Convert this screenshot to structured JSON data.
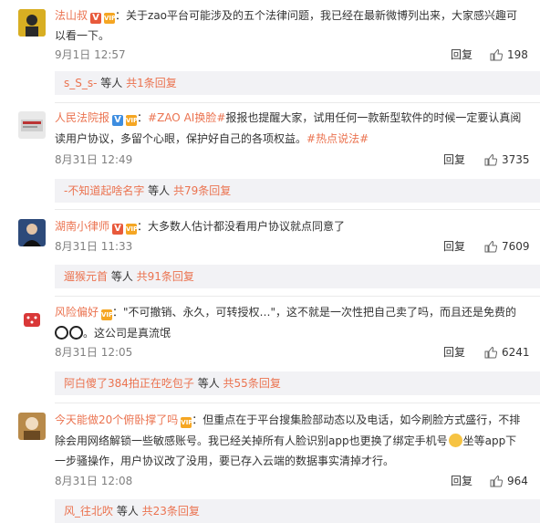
{
  "comments": [
    {
      "user": "法山叔",
      "text": "：关于zao平台可能涉及的五个法律问题，我已经在最新微博列出来，大家感兴趣可",
      "text2": "以看一下。",
      "time": "9月1日 12:57",
      "reply": "回复",
      "likes": "198",
      "sub_user": "s_S_s-",
      "sub_mid": " 等人 ",
      "sub_count": "共1条回复"
    },
    {
      "user": "人民法院报",
      "topic1": "#ZAO AI换脸#",
      "text": "报报也提醒大家，试用任何一款新型软件的时候一定要认真阅",
      "text2": "读用户协议，多留个心眼，保护好自己的各项权益。",
      "topic2": "#热点说法#",
      "time": "8月31日 12:49",
      "reply": "回复",
      "likes": "3735",
      "sub_user": "-不知道起啥名字",
      "sub_mid": " 等人 ",
      "sub_count": "共79条回复"
    },
    {
      "user": "湖南小律师",
      "text": "：大多数人估计都没看用户协议就点同意了",
      "time": "8月31日 11:33",
      "reply": "回复",
      "likes": "7609",
      "sub_user": "遛猴元首",
      "sub_mid": " 等人 ",
      "sub_count": "共91条回复"
    },
    {
      "user": "风险偏好",
      "text": "：\"不可撤销、永久，可转授权…\"，这不就是一次性把自己卖了吗，而且还是免费的",
      "text2": "。这公司是真流氓",
      "time": "8月31日 12:05",
      "reply": "回复",
      "likes": "6241",
      "sub_user": "阿白傻了384拍正在吃包子",
      "sub_mid": " 等人 ",
      "sub_count": "共55条回复"
    },
    {
      "user": "今天能做20个俯卧撑了吗",
      "text": "：但重点在于平台搜集脸部动态以及电话，如今刷脸方式盛行，不排",
      "text2": "除会用网络解锁一些敏感账号。我已经关掉所有人脸识别app也更换了绑定手机号",
      "text2b": "坐等app下",
      "text3": "一步骚操作，用户协议改了没用，要已存入云端的数据事实清掉才行。",
      "time": "8月31日 12:08",
      "reply": "回复",
      "likes": "964",
      "sub_user": "风_往北吹",
      "sub_mid": " 等人 ",
      "sub_count": "共23条回复"
    }
  ]
}
